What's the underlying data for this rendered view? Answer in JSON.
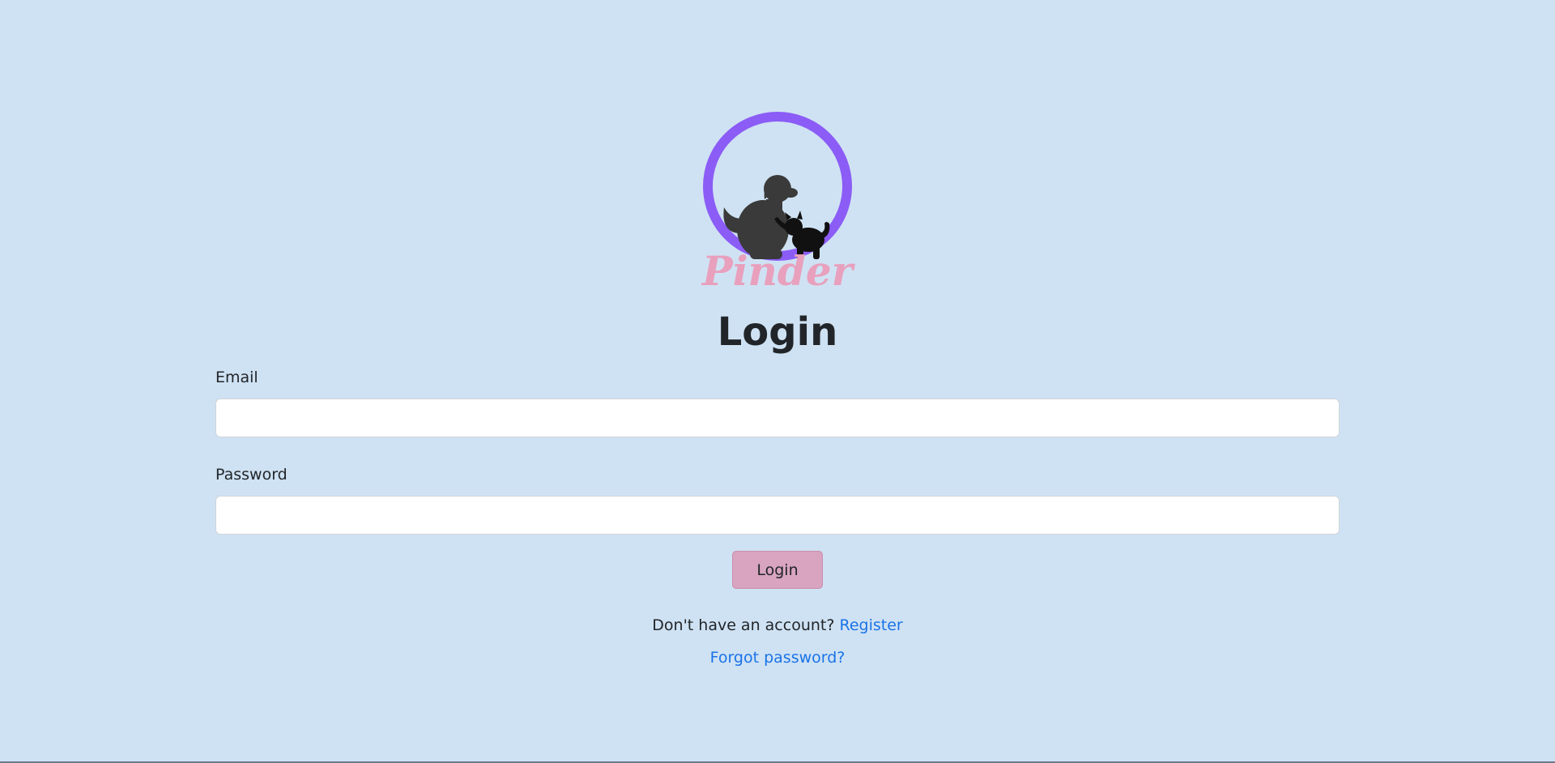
{
  "brand": {
    "name": "Pinder",
    "ring_color": "#8b5cf6",
    "wordmark_color": "#e8a0bd",
    "silhouette_color": "#333333"
  },
  "page": {
    "title": "Login",
    "background_color": "#cfe2f3"
  },
  "form": {
    "email": {
      "label": "Email",
      "value": "",
      "placeholder": ""
    },
    "password": {
      "label": "Password",
      "value": "",
      "placeholder": ""
    },
    "submit_label": "Login",
    "submit_color": "#d8a4bf"
  },
  "footer": {
    "register_prompt": "Don't have an account?",
    "register_link": "Register",
    "forgot_link": "Forgot password?",
    "link_color": "#1a73e8"
  }
}
